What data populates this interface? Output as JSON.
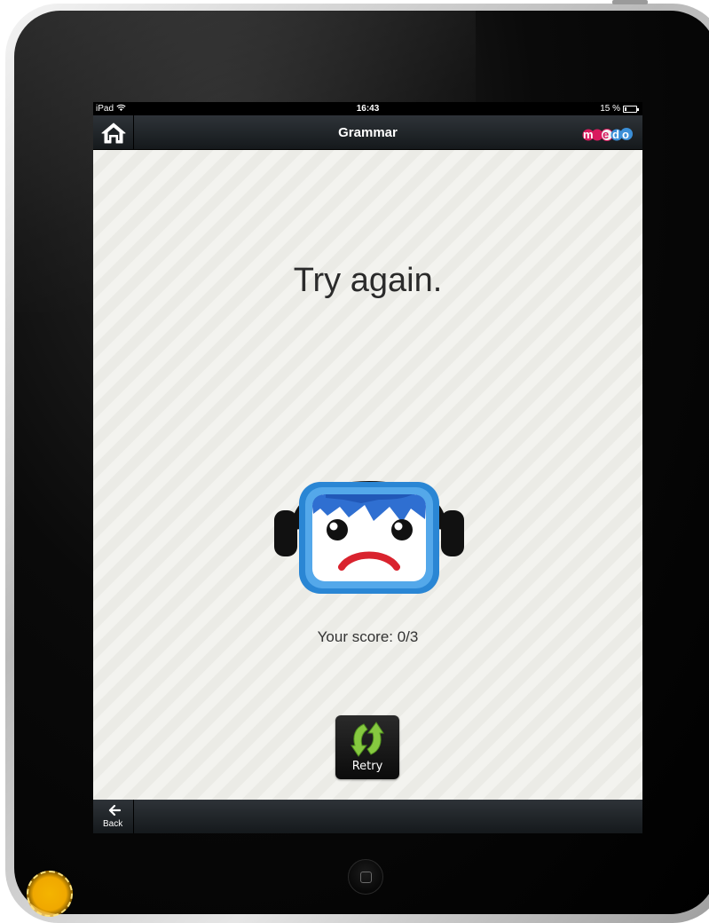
{
  "status_bar": {
    "device": "iPad",
    "wifi_icon": "wifi-icon",
    "time": "16:43",
    "battery_percent": "15 %",
    "battery_level": 0.15
  },
  "nav_bar": {
    "title": "Grammar",
    "home_icon": "home-icon",
    "logo_text": "medo"
  },
  "result": {
    "title": "Try again.",
    "mascot_icon": "sad-headphones-face-icon",
    "score": "Your score: 0/3"
  },
  "retry_button": {
    "label": "Retry",
    "icon": "refresh-arrows-icon"
  },
  "bottom_bar": {
    "back_label": "Back",
    "back_icon": "back-arrow-icon"
  },
  "colors": {
    "nav_bar": "#1f2428",
    "content_bg": "#f1f1ec",
    "retry_arrows": "#7dc242",
    "face_frame": "#2b8fd8",
    "hair": "#2f6fd1",
    "frown": "#d9232e",
    "touch_indicator": "#f4b400"
  }
}
